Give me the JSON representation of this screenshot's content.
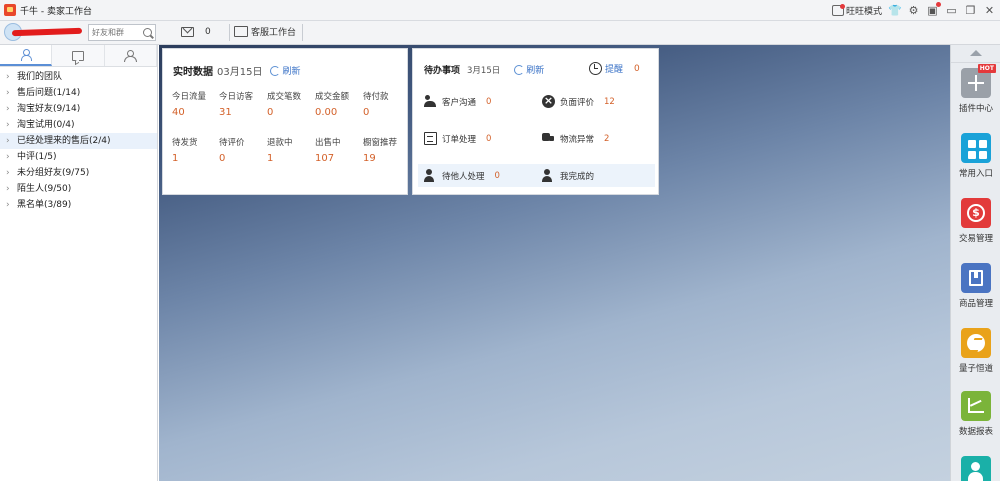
{
  "window": {
    "title": "千牛 - 卖家工作台",
    "wangwang_mode_label": "旺旺模式"
  },
  "toolbar": {
    "search_placeholder": "好友和群",
    "mail_count": "0",
    "customer_service_label": "客服工作台"
  },
  "sidebar": {
    "groups": [
      {
        "label": "我们的团队"
      },
      {
        "label": "售后问题(1/14)"
      },
      {
        "label": "淘宝好友(9/14)"
      },
      {
        "label": "淘宝试用(0/4)"
      },
      {
        "label": "已经处理来的售后(2/4)"
      },
      {
        "label": "中评(1/5)"
      },
      {
        "label": "未分组好友(9/75)"
      },
      {
        "label": "陌生人(9/50)"
      },
      {
        "label": "黑名单(3/89)"
      }
    ]
  },
  "realtime": {
    "title": "实时数据",
    "date": "03月15日",
    "refresh_label": "刷新",
    "metrics": [
      {
        "label": "今日流量",
        "value": "40"
      },
      {
        "label": "今日访客",
        "value": "31"
      },
      {
        "label": "成交笔数",
        "value": "0"
      },
      {
        "label": "成交金额",
        "value": "0.00"
      },
      {
        "label": "待付款",
        "value": "0"
      },
      {
        "label": "待发货",
        "value": "1"
      },
      {
        "label": "待评价",
        "value": "0"
      },
      {
        "label": "退款中",
        "value": "1"
      },
      {
        "label": "出售中",
        "value": "107"
      },
      {
        "label": "橱窗推荐",
        "value": "19"
      }
    ]
  },
  "todo": {
    "title": "待办事项",
    "date": "3月15日",
    "refresh_label": "刷新",
    "reminder_label": "提醒",
    "reminder_count": "0",
    "items": [
      {
        "label": "客户沟通",
        "count": "0",
        "icon": "people-icon"
      },
      {
        "label": "负面评价",
        "count": "12",
        "icon": "negative-review-icon"
      },
      {
        "label": "订单处理",
        "count": "0",
        "icon": "order-icon"
      },
      {
        "label": "物流异常",
        "count": "2",
        "icon": "truck-icon"
      },
      {
        "label": "待他人处理",
        "count": "0",
        "icon": "user-icon"
      },
      {
        "label": "我完成的",
        "icon": "user-check-icon"
      }
    ]
  },
  "rightbar": {
    "hot_badge": "HOT",
    "items": [
      {
        "label": "插件中心",
        "color": "#9aa0a8",
        "icon": "plus-icon"
      },
      {
        "label": "常用入口",
        "color": "#1aa2d8",
        "icon": "grid-icon"
      },
      {
        "label": "交易管理",
        "color": "#e23a3a",
        "icon": "money-icon"
      },
      {
        "label": "商品管理",
        "color": "#4a74c2",
        "icon": "box-icon"
      },
      {
        "label": "量子恒道",
        "color": "#e9a21a",
        "icon": "quantum-icon"
      },
      {
        "label": "数据报表",
        "color": "#7bb43a",
        "icon": "chart-icon"
      },
      {
        "label": "",
        "color": "#1ab0a8",
        "icon": "user-icon"
      }
    ]
  },
  "colors": {
    "accent": "#3b73c7",
    "value_orange": "#d3612a"
  }
}
